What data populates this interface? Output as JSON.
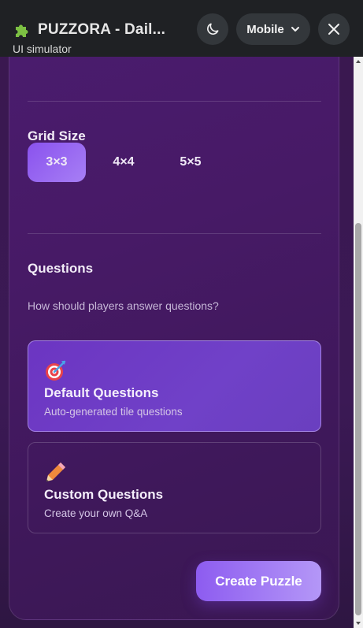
{
  "topbar": {
    "title": "PUZZORA - Dail...",
    "subtitle": "UI simulator",
    "app_icon": "puzzle-piece-icon",
    "theme_icon": "moon-icon",
    "mode_label": "Mobile",
    "mode_icon": "chevron-down-icon",
    "close_icon": "close-icon"
  },
  "grid_size": {
    "heading": "Grid Size",
    "options": [
      "3×3",
      "4×4",
      "5×5"
    ],
    "selected": "3×3"
  },
  "questions": {
    "heading": "Questions",
    "hint": "How should players answer questions?",
    "options": [
      {
        "icon": "target-icon",
        "title": "Default Questions",
        "desc": "Auto-generated tile questions",
        "selected": true
      },
      {
        "icon": "pencil-icon",
        "title": "Custom Questions",
        "desc": "Create your own Q&A",
        "selected": false
      }
    ]
  },
  "actions": {
    "create_label": "Create Puzzle"
  },
  "colors": {
    "accent": "#8a52ee",
    "background": "#471a66",
    "topbar": "#1f2124"
  }
}
